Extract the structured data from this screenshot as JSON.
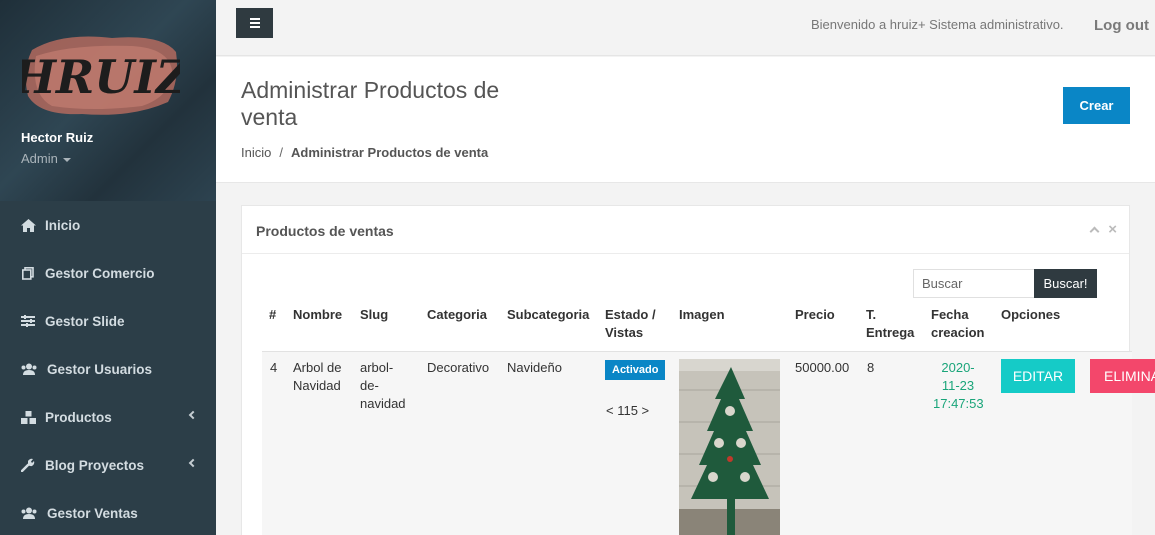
{
  "sidebar": {
    "logo_text": "HRUIZ",
    "user_name": "Hector Ruiz",
    "user_role": "Admin",
    "items": [
      {
        "label": "Inicio",
        "icon": "home-icon",
        "has_submenu": false
      },
      {
        "label": "Gestor Comercio",
        "icon": "copy-icon",
        "has_submenu": false
      },
      {
        "label": "Gestor Slide",
        "icon": "sliders-icon",
        "has_submenu": false
      },
      {
        "label": "Gestor Usuarios",
        "icon": "users-icon",
        "has_submenu": false
      },
      {
        "label": "Productos",
        "icon": "cubes-icon",
        "has_submenu": true
      },
      {
        "label": "Blog Proyectos",
        "icon": "wrench-icon",
        "has_submenu": true
      },
      {
        "label": "Gestor Ventas",
        "icon": "users-icon",
        "has_submenu": false
      }
    ]
  },
  "topbar": {
    "welcome": "Bienvenido a hruiz+ Sistema administrativo.",
    "logout": "Log out"
  },
  "header": {
    "title": "Administrar Productos de venta",
    "breadcrumb": [
      "Inicio",
      "Administrar Productos de venta"
    ],
    "create_label": "Crear"
  },
  "panel": {
    "title": "Productos de ventas",
    "search_placeholder": "Buscar",
    "search_button": "Buscar!",
    "columns": [
      "#",
      "Nombre",
      "Slug",
      "Categoria",
      "Subcategoria",
      "Estado / Vistas",
      "Imagen",
      "Precio",
      "T. Entrega",
      "Fecha creacion",
      "Opciones"
    ],
    "rows": [
      {
        "id": "4",
        "nombre": "Arbol de Navidad",
        "slug": "arbol-de-navidad",
        "categoria": "Decorativo",
        "subcategoria": "Navideño",
        "estado": "Activado",
        "vistas": "< 115 >",
        "precio": "50000.00",
        "entrega": "8",
        "fecha": "2020-11-23 17:47:53",
        "edit_label": "EDITAR",
        "delete_label": "ELIMINAR"
      }
    ]
  },
  "colors": {
    "sidebar_bg": "#2c3e48",
    "primary": "#0a86c6",
    "edit": "#15cbc7",
    "delete": "#f3476b",
    "date": "#1aa57a"
  }
}
